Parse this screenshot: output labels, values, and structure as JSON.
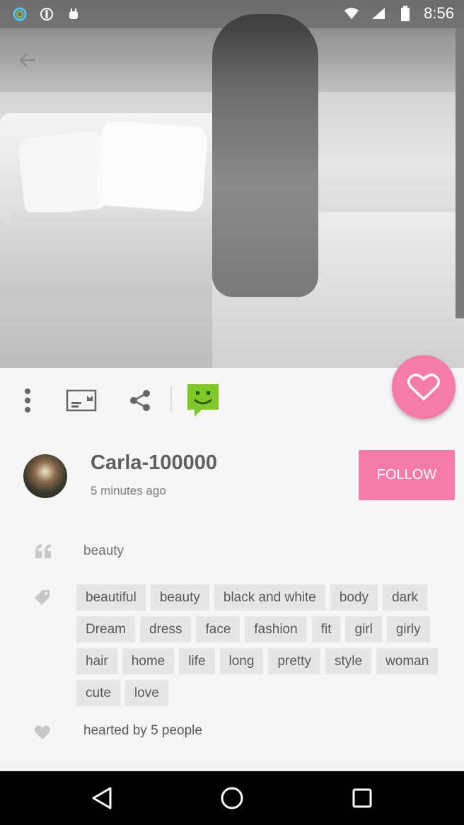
{
  "status_bar": {
    "time": "8:56",
    "left_icons": [
      "circle-app-icon",
      "alert-icon",
      "android-icon"
    ],
    "right_icons": [
      "wifi-icon",
      "signal-icon",
      "battery-icon"
    ]
  },
  "post": {
    "username": "Carla-100000",
    "time_ago": "5 minutes ago",
    "follow_label": "FOLLOW",
    "caption": "beauty",
    "tags": [
      "beautiful",
      "beauty",
      "black and white",
      "body",
      "dark",
      "Dream",
      "dress",
      "face",
      "fashion",
      "fit",
      "girl",
      "girly",
      "hair",
      "home",
      "life",
      "long",
      "pretty",
      "style",
      "woman",
      "cute",
      "love"
    ],
    "hearted_text": "hearted by 5 people"
  },
  "actions": {
    "icons": [
      "more-vert-icon",
      "save-board-icon",
      "share-icon",
      "chat-smiley-icon",
      "heart-icon"
    ]
  },
  "colors": {
    "accent_pink": "#f57ca6",
    "chat_green": "#7ec82a",
    "tag_bg": "#e6e6e6"
  },
  "navbar": {
    "icons": [
      "back-triangle-icon",
      "home-circle-icon",
      "recents-square-icon"
    ]
  }
}
